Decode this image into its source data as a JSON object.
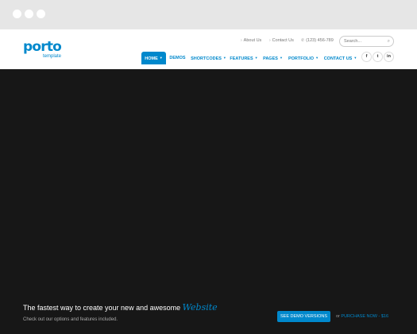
{
  "colors": {
    "accent": "#0088cc",
    "chrome": "#e6e6e6",
    "hero_bg": "#171717"
  },
  "logo": {
    "main": "porto",
    "sub": "template"
  },
  "topbar": {
    "about": {
      "icon": "chevron-right-icon",
      "label": "About Us"
    },
    "contact": {
      "icon": "chevron-right-icon",
      "label": "Contact Us"
    },
    "phone": {
      "icon": "phone-icon",
      "label": "(123) 456-789"
    }
  },
  "search": {
    "placeholder": "Search...",
    "icon": "search-icon"
  },
  "nav": {
    "home": "HOME",
    "demos": "DEMOS",
    "shortcodes": "SHORTCODES",
    "features": "FEATURES",
    "pages": "PAGES",
    "portfolio": "PORTFOLIO",
    "contact": "CONTACT US"
  },
  "social": {
    "facebook": "f",
    "twitter": "t",
    "linkedin": "in"
  },
  "hero": {
    "tagline_prefix": "The fastest way to create your new and awesome",
    "tagline_accent": "Website",
    "subline": "Check out our options and features included.",
    "demo_button": "SEE DEMO VERSIONS",
    "or_text": "or",
    "purchase_link": "PURCHASE NOW - $16"
  }
}
